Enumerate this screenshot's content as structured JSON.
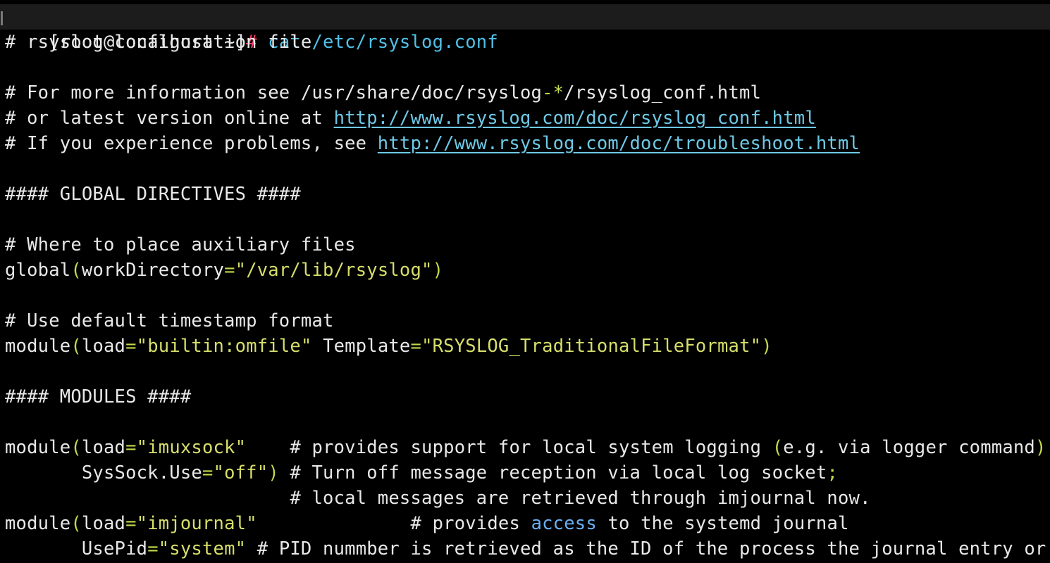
{
  "terminal": {
    "prompt": "[root@localhost ~]",
    "prompt_hash": "#",
    "command": " cat /etc/rsyslog.conf",
    "lines": {
      "l1": "# rsyslog configuration file",
      "l3": "# For more information see /usr/share/doc/rsyslog",
      "l3_dash": "-*",
      "l3_end": "/rsyslog_conf.html",
      "l4_pre": "# or latest version online at ",
      "l4_link": "http://www.rsyslog.com/doc/rsyslog_conf.html",
      "l5_pre": "# If you experience problems, see ",
      "l5_link": "http://www.rsyslog.com/doc/troubleshoot.html",
      "l7": "#### GLOBAL DIRECTIVES ####",
      "l9": "# Where to place auxiliary files",
      "l10_a": "global",
      "l10_b": "workDirectory",
      "l10_str": "\"/var/lib/rsyslog\"",
      "l12": "# Use default timestamp format",
      "l13_a": "module",
      "l13_b": "load",
      "l13_str1": "\"builtin:omfile\"",
      "l13_c": " Template",
      "l13_str2": "\"RSYSLOG_TraditionalFileFormat\"",
      "l15": "#### MODULES ####",
      "l17_a": "module",
      "l17_b": "load",
      "l17_str": "\"imuxsock\"",
      "l17_c": "    # provides support for local system logging ",
      "l17_d": "e.g. via logger command",
      "l18_a": "       SysSock.Use",
      "l18_str": "\"off\"",
      "l18_c": " # Turn off message reception via local log socket",
      "l18_semi": ";",
      "l19": "                          # local messages are retrieved through imjournal now.",
      "l20_a": "module",
      "l20_b": "load",
      "l20_str": "\"imjournal\"",
      "l20_c": "              # provides ",
      "l20_kw": "access",
      "l20_d": " to the systemd journal",
      "l21_a": "       UsePid",
      "l21_str": "\"system\"",
      "l21_c": " # PID nummber is retrieved as the ID of the process the journal entry or"
    }
  }
}
